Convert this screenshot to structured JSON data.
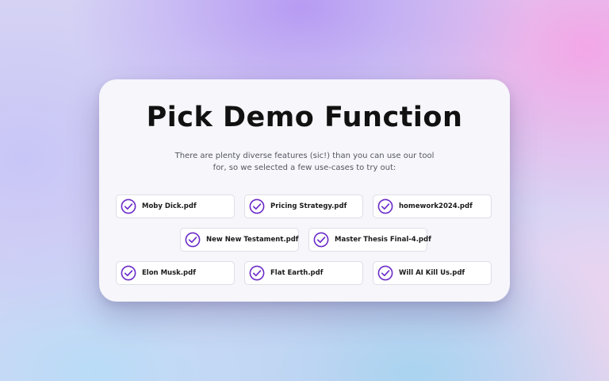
{
  "dialog": {
    "title": "Pick Demo Function",
    "subtitle": "There are plenty diverse features (sic!) than you can use our tool for, so we selected a few use-cases to try out:"
  },
  "options": [
    {
      "label": "Moby Dick.pdf",
      "icon": "check-circle-icon"
    },
    {
      "label": "Pricing Strategy.pdf",
      "icon": "check-circle-icon"
    },
    {
      "label": "homework2024.pdf",
      "icon": "check-circle-icon"
    },
    {
      "label": "New New Testament.pdf",
      "icon": "check-circle-icon"
    },
    {
      "label": "Master Thesis Final-4.pdf",
      "icon": "check-circle-icon"
    },
    {
      "label": "Elon Musk.pdf",
      "icon": "check-circle-icon"
    },
    {
      "label": "Flat Earth.pdf",
      "icon": "check-circle-icon"
    },
    {
      "label": "Will AI Kill Us.pdf",
      "icon": "check-circle-icon"
    }
  ],
  "colors": {
    "accent": "#6a2bc8",
    "card": "#f6f6fb",
    "chip_border": "#dedfe6"
  }
}
